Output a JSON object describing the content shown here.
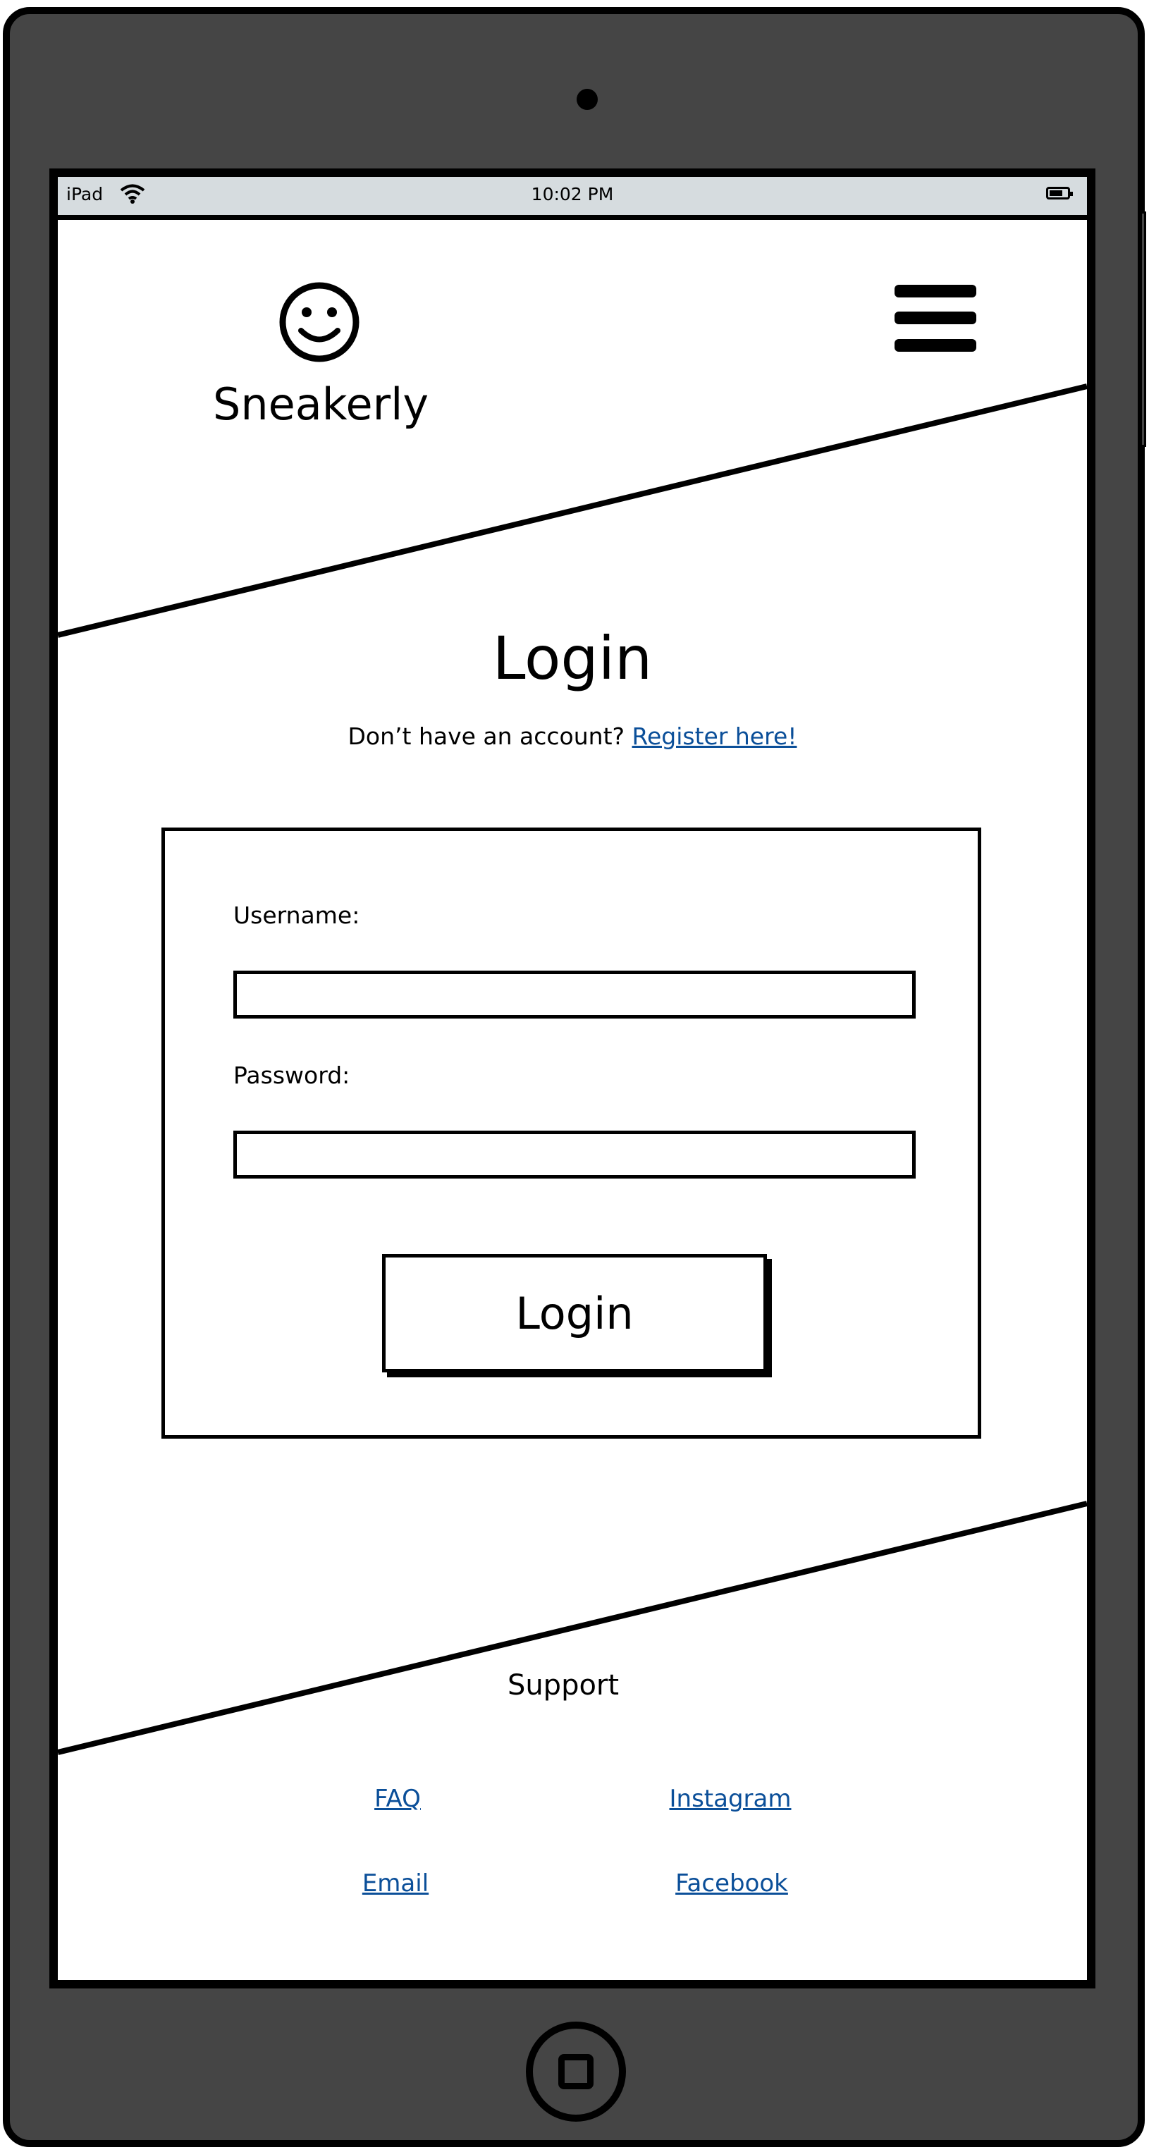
{
  "statusbar": {
    "carrier": "iPad",
    "time": "10:02 PM"
  },
  "header": {
    "brand": "Sneakerly",
    "logo_icon": "smiley-face-icon",
    "menu_icon": "hamburger-menu-icon"
  },
  "login": {
    "title": "Login",
    "prompt": "Don’t have an account?",
    "register_link": "Register here!",
    "username_label": "Username:",
    "username_value": "",
    "password_label": "Password:",
    "password_value": "",
    "submit_label": "Login"
  },
  "footer": {
    "heading": "Support",
    "links": [
      "FAQ",
      "Instagram",
      "Email",
      "Facebook"
    ]
  },
  "colors": {
    "device": "#454545",
    "statusbar": "#d6dcdf",
    "link": "#0b4f99"
  }
}
